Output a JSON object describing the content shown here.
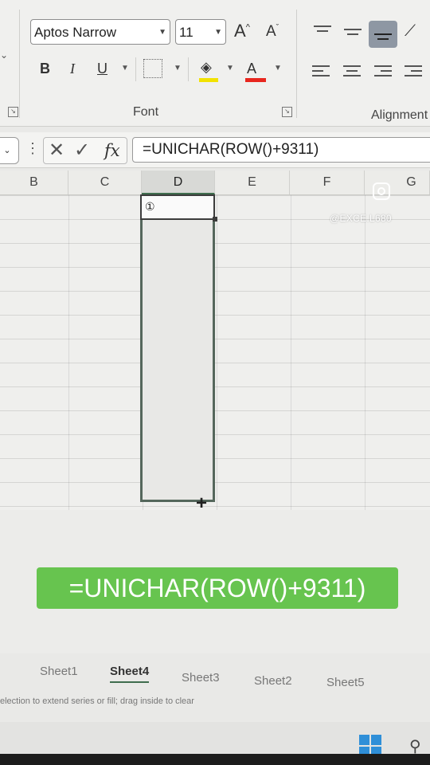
{
  "ribbon": {
    "font_name": "Aptos Narrow",
    "font_size": "11",
    "grow_font": "A",
    "shrink_font": "A",
    "bold": "B",
    "italic": "I",
    "underline": "U",
    "font_color": "A",
    "font_group_label": "Font",
    "alignment_group_label": "Alignment"
  },
  "formula_bar": {
    "fx": "fx",
    "formula": "=UNICHAR(ROW()+9311)"
  },
  "columns": [
    "B",
    "C",
    "D",
    "E",
    "F",
    "G"
  ],
  "selected_column": "D",
  "active_cell_value": "①",
  "watermark": "@EXCE.L680",
  "banner_text": "=UNICHAR(ROW()+9311)",
  "sheets": [
    {
      "label": "Sheet1",
      "active": false
    },
    {
      "label": "Sheet4",
      "active": true
    },
    {
      "label": "Sheet3",
      "active": false
    },
    {
      "label": "Sheet2",
      "active": false
    },
    {
      "label": "Sheet5",
      "active": false
    }
  ],
  "status_text": "election to extend series or fill; drag inside to clear",
  "colors": {
    "banner": "#67c44f",
    "selection_border": "#55675c",
    "fill_color": "#f2e200",
    "font_color": "#e8261e"
  }
}
